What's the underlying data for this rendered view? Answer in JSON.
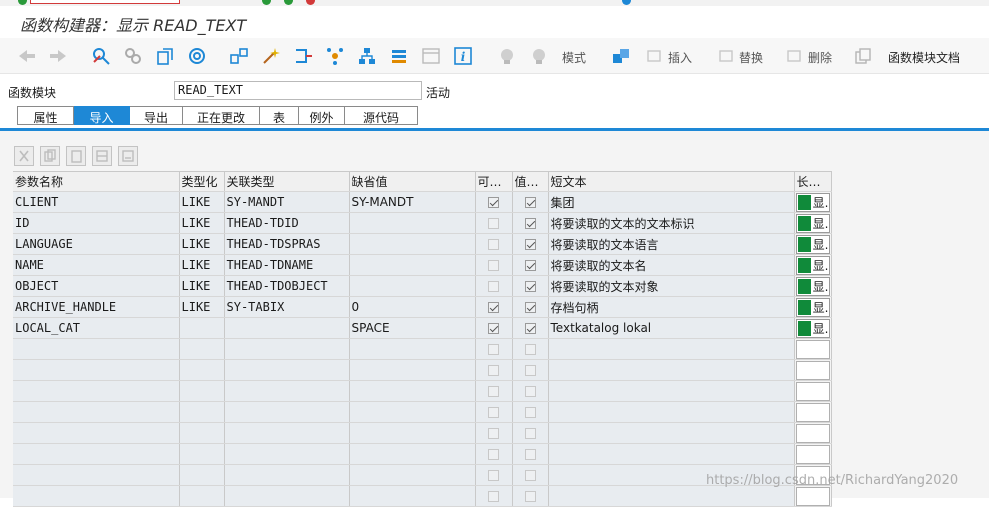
{
  "title": "函数构建器：显示 READ_TEXT",
  "toolbar": {
    "buttons": {
      "mode": "模式",
      "insert": "插入",
      "replace": "替换",
      "delete": "删除",
      "docs": "函数模块文档"
    }
  },
  "function_module": {
    "label": "函数模块",
    "value": "READ_TEXT",
    "status": "活动"
  },
  "tabs": [
    {
      "label": "属性"
    },
    {
      "label": "导入"
    },
    {
      "label": "导出"
    },
    {
      "label": "正在更改"
    },
    {
      "label": "表"
    },
    {
      "label": "例外"
    },
    {
      "label": "源代码"
    }
  ],
  "active_tab": "导入",
  "table": {
    "columns": [
      "参数名称",
      "类型化",
      "关联类型",
      "缺省值",
      "可…",
      "值…",
      "短文本",
      "长…"
    ],
    "rows": [
      {
        "name": "CLIENT",
        "typing": "LIKE",
        "ref_type": "SY-MANDT",
        "default": "SY-MANDT",
        "optional": true,
        "pass_value": true,
        "short_text": "集团",
        "long_text": "显."
      },
      {
        "name": "ID",
        "typing": "LIKE",
        "ref_type": "THEAD-TDID",
        "default": "",
        "optional": false,
        "pass_value": true,
        "short_text": "将要读取的文本的文本标识",
        "long_text": "显."
      },
      {
        "name": "LANGUAGE",
        "typing": "LIKE",
        "ref_type": "THEAD-TDSPRAS",
        "default": "",
        "optional": false,
        "pass_value": true,
        "short_text": "将要读取的文本语言",
        "long_text": "显."
      },
      {
        "name": "NAME",
        "typing": "LIKE",
        "ref_type": "THEAD-TDNAME",
        "default": "",
        "optional": false,
        "pass_value": true,
        "short_text": "将要读取的文本名",
        "long_text": "显."
      },
      {
        "name": "OBJECT",
        "typing": "LIKE",
        "ref_type": "THEAD-TDOBJECT",
        "default": "",
        "optional": false,
        "pass_value": true,
        "short_text": "将要读取的文本对象",
        "long_text": "显."
      },
      {
        "name": "ARCHIVE_HANDLE",
        "typing": "LIKE",
        "ref_type": "SY-TABIX",
        "default": "0",
        "optional": true,
        "pass_value": true,
        "short_text": "存档句柄",
        "long_text": "显."
      },
      {
        "name": "LOCAL_CAT",
        "typing": "",
        "ref_type": "",
        "default": "SPACE",
        "optional": true,
        "pass_value": true,
        "short_text": "Textkatalog lokal",
        "long_text": "显."
      }
    ],
    "empty_rows": 8
  },
  "watermark": "https://blog.csdn.net/RichardYang2020",
  "colors": {
    "accent": "#1e88d6",
    "green": "#108a3a",
    "grid_cell": "#e8ecf0"
  }
}
